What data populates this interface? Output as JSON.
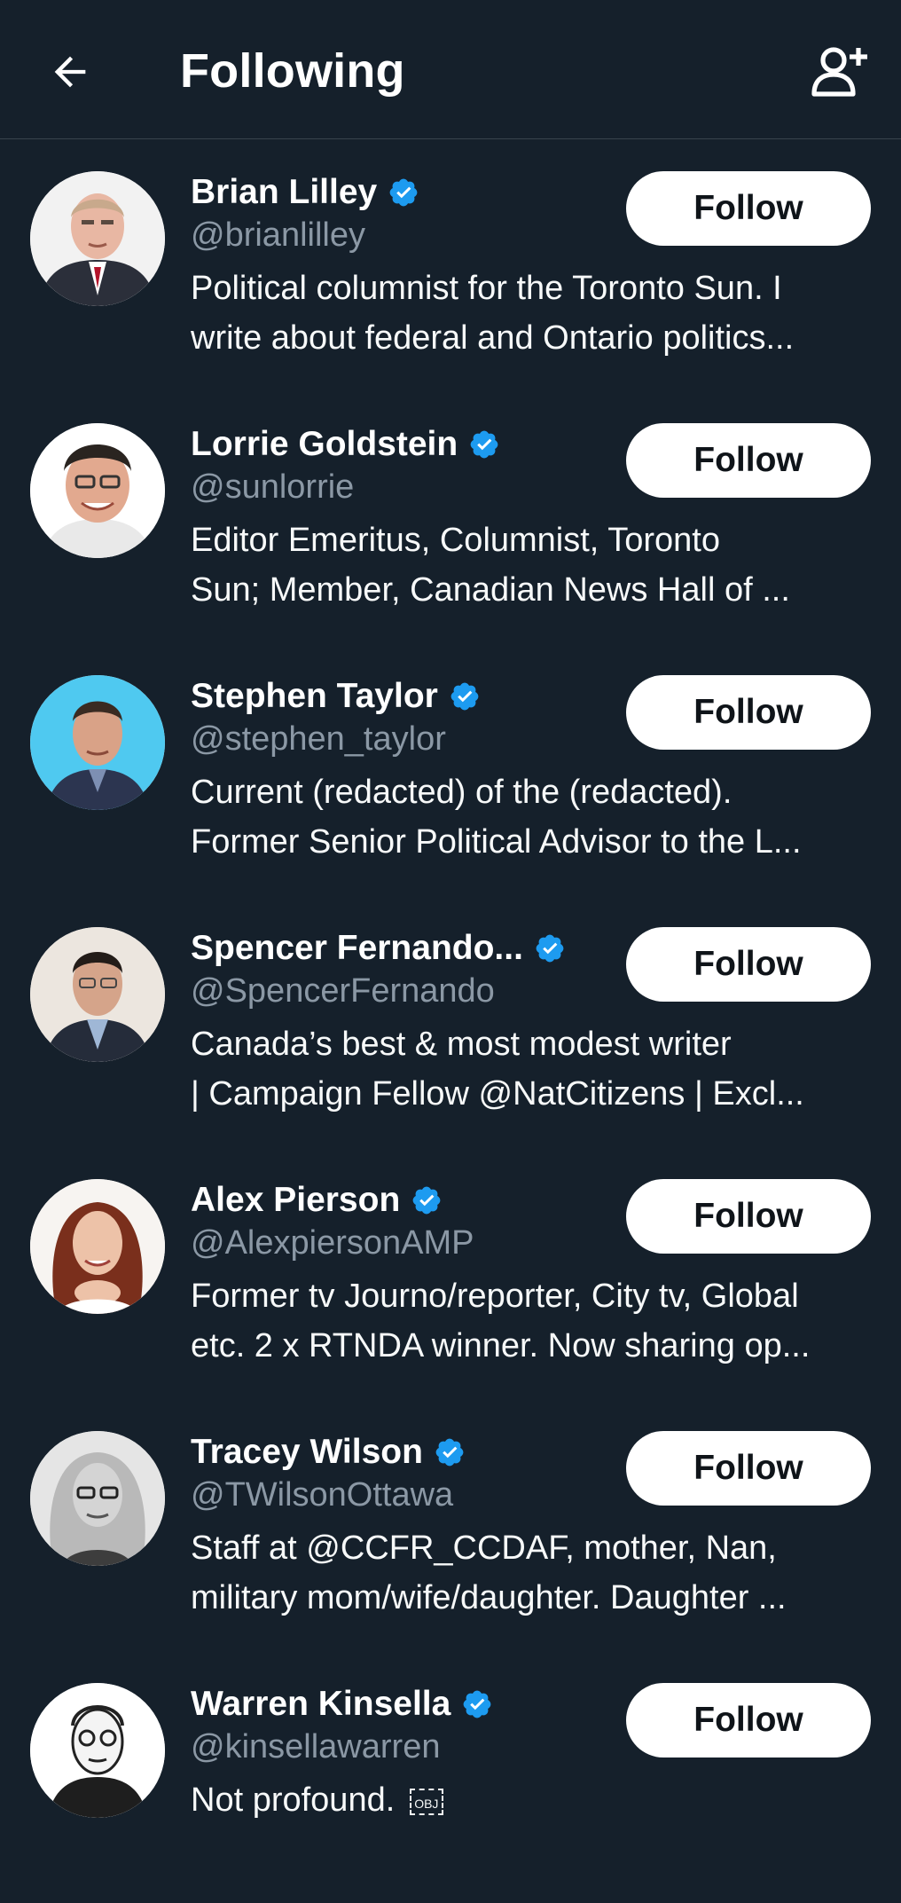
{
  "header": {
    "title": "Following",
    "back_icon": "arrow-left-icon",
    "add_icon": "add-user-icon"
  },
  "colors": {
    "background": "#15202b",
    "verified": "#1d9bf0",
    "handle": "#8b98a5",
    "button_bg": "#ffffff",
    "button_text": "#0f1419"
  },
  "users": [
    {
      "name": "Brian Lilley",
      "handle": "@brianlilley",
      "bio1": "Political columnist for the Toronto Sun. I",
      "bio2": "write about federal and Ontario politics...",
      "button": "Follow"
    },
    {
      "name": "Lorrie Goldstein",
      "handle": "@sunlorrie",
      "bio1": "Editor Emeritus, Columnist, Toronto",
      "bio2": "Sun;  Member, Canadian News Hall of ...",
      "button": "Follow"
    },
    {
      "name": "Stephen Taylor",
      "handle": "@stephen_taylor",
      "bio1": "Current (redacted) of the (redacted).",
      "bio2": "Former Senior Political Advisor to the L...",
      "button": "Follow"
    },
    {
      "name": "Spencer Fernando...",
      "handle": "@SpencerFernando",
      "bio1": "Canada’s best & most modest writer",
      "bio2": "| Campaign Fellow @NatCitizens | Excl...",
      "button": "Follow"
    },
    {
      "name": "Alex Pierson",
      "handle": "@AlexpiersonAMP",
      "bio1": "Former tv Journo/reporter, City tv, Global",
      "bio2": "etc. 2 x RTNDA winner. Now sharing op...",
      "button": "Follow"
    },
    {
      "name": "Tracey Wilson",
      "handle": "@TWilsonOttawa",
      "bio1": "Staff at @CCFR_CCDAF, mother, Nan,",
      "bio2": "military mom/wife/daughter. Daughter ...",
      "button": "Follow"
    },
    {
      "name": "Warren Kinsella",
      "handle": "@kinsellawarren",
      "bio1": "Not profound.",
      "bio1_glyph": "OBJ",
      "bio2": "",
      "button": "Follow"
    }
  ]
}
